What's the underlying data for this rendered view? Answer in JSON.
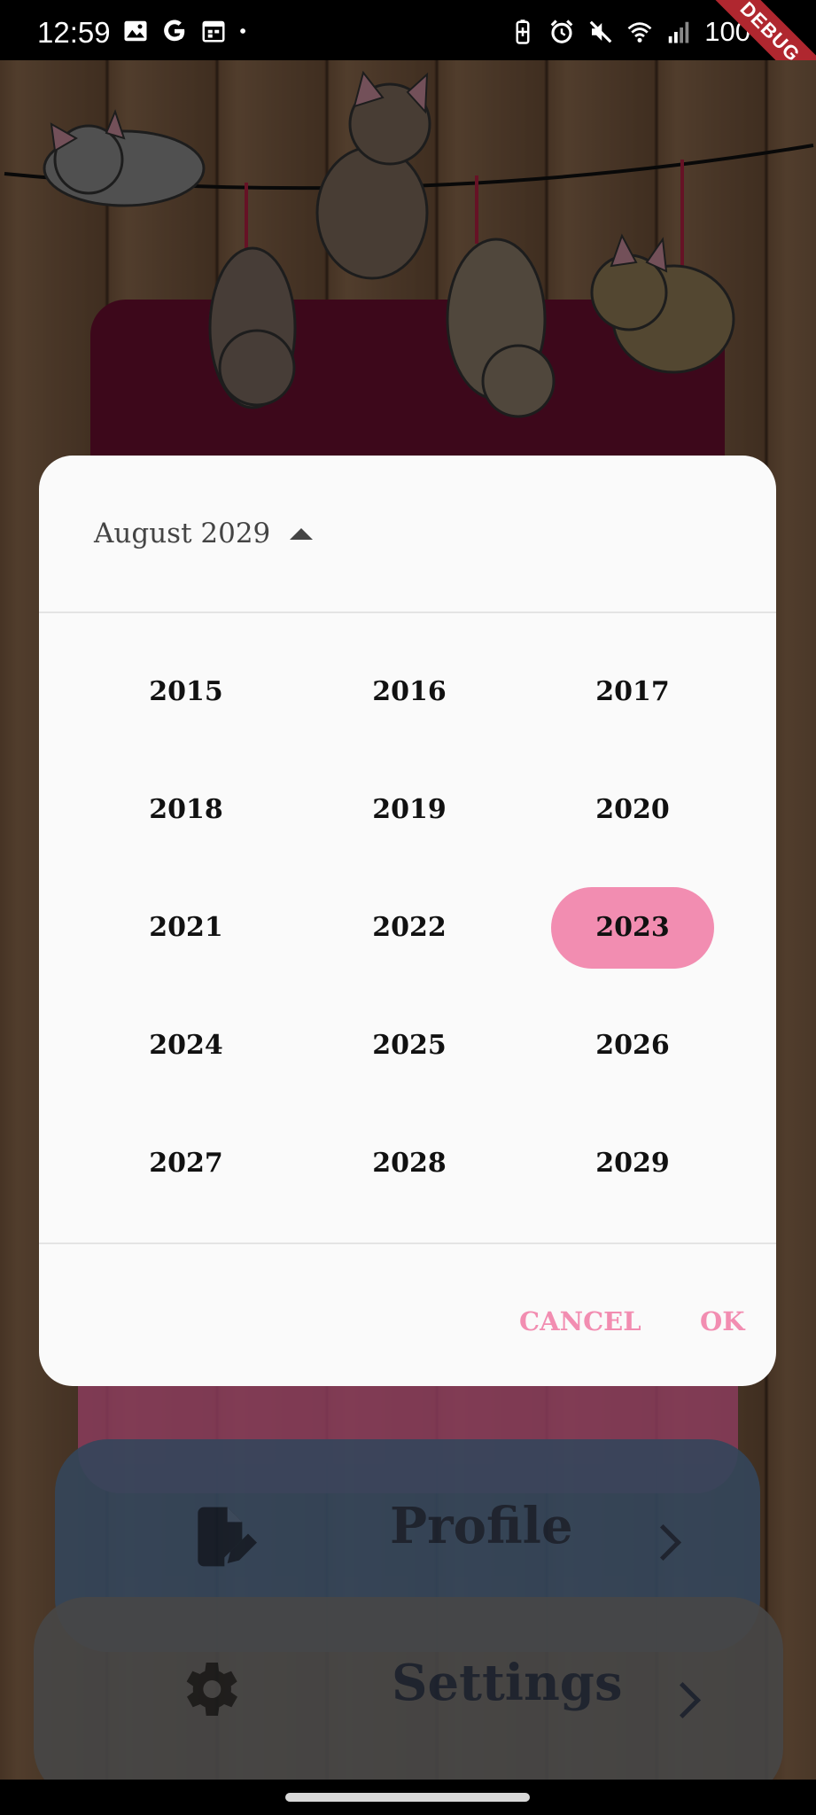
{
  "status_bar": {
    "time": "12:59",
    "battery": "100",
    "left_icons": [
      "image-icon",
      "google-icon",
      "calendar-icon",
      "dot-icon"
    ],
    "right_icons": [
      "battery-saver-icon",
      "alarm-icon",
      "mute-icon",
      "wifi-icon",
      "signal-icon",
      "battery-icon"
    ],
    "debug_banner": "DEBUG"
  },
  "dialog": {
    "month_year": "August 2029",
    "years": [
      "2015",
      "2016",
      "2017",
      "2018",
      "2019",
      "2020",
      "2021",
      "2022",
      "2023",
      "2024",
      "2025",
      "2026",
      "2027",
      "2028",
      "2029"
    ],
    "selected_year": "2023",
    "cancel_label": "CANCEL",
    "ok_label": "OK",
    "accent_color": "#f28db1"
  },
  "menu": {
    "profile_label": "Profile",
    "settings_label": "Settings",
    "profile_icon": "edit-document-icon",
    "settings_icon": "gear-icon"
  }
}
